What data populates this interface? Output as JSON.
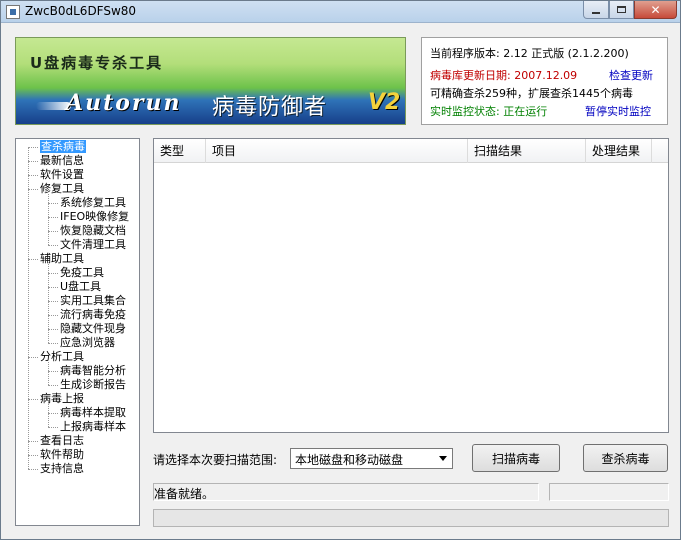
{
  "window": {
    "title": "ZwcB0dL6DFSw80"
  },
  "banner": {
    "title": "U盘病毒专杀工具",
    "brand": "Autorun",
    "subtitle": "病毒防御者",
    "version_badge": "V2"
  },
  "info": {
    "version_line": "当前程序版本: 2.12 正式版 (2.1.2.200)",
    "db_update_line": "病毒库更新日期: 2007.12.09",
    "check_update_link": "检查更新",
    "capability_line": "可精确查杀259种，扩展查杀1445个病毒",
    "monitor_status_line": "实时监控状态: 正在运行",
    "pause_monitor_link": "暂停实时监控"
  },
  "tree": {
    "items": [
      {
        "label": "查杀病毒",
        "level": 0,
        "selected": true
      },
      {
        "label": "最新信息",
        "level": 0
      },
      {
        "label": "软件设置",
        "level": 0
      },
      {
        "label": "修复工具",
        "level": 0
      },
      {
        "label": "系统修复工具",
        "level": 1
      },
      {
        "label": "IFEO映像修复",
        "level": 1
      },
      {
        "label": "恢复隐藏文档",
        "level": 1
      },
      {
        "label": "文件清理工具",
        "level": 1
      },
      {
        "label": "辅助工具",
        "level": 0
      },
      {
        "label": "免疫工具",
        "level": 1
      },
      {
        "label": "U盘工具",
        "level": 1
      },
      {
        "label": "实用工具集合",
        "level": 1
      },
      {
        "label": "流行病毒免疫",
        "level": 1
      },
      {
        "label": "隐藏文件现身",
        "level": 1
      },
      {
        "label": "应急浏览器",
        "level": 1
      },
      {
        "label": "分析工具",
        "level": 0
      },
      {
        "label": "病毒智能分析",
        "level": 1
      },
      {
        "label": "生成诊断报告",
        "level": 1
      },
      {
        "label": "病毒上报",
        "level": 0
      },
      {
        "label": "病毒样本提取",
        "level": 1
      },
      {
        "label": "上报病毒样本",
        "level": 1
      },
      {
        "label": "查看日志",
        "level": 0
      },
      {
        "label": "软件帮助",
        "level": 0
      },
      {
        "label": "支持信息",
        "level": 0
      }
    ]
  },
  "list": {
    "columns": [
      "类型",
      "项目",
      "扫描结果",
      "处理结果"
    ],
    "rows": []
  },
  "controls": {
    "scope_label": "请选择本次要扫描范围:",
    "scope_selected": "本地磁盘和移动磁盘",
    "scan_button": "扫描病毒",
    "kill_button": "查杀病毒"
  },
  "status": {
    "text": "准备就绪。",
    "progress": 0
  },
  "colors": {
    "selection": "#3399ff",
    "db_date": "#c00000",
    "monitor": "#008000",
    "link": "#0000c0"
  }
}
